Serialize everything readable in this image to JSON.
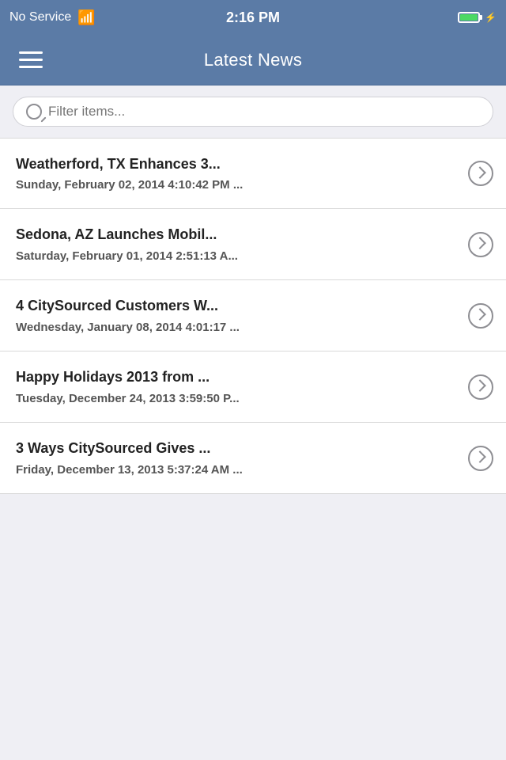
{
  "statusBar": {
    "signal": "No Service",
    "wifi": "⊙",
    "time": "2:16 PM"
  },
  "navBar": {
    "title": "Latest News",
    "menuIcon": "≡"
  },
  "search": {
    "placeholder": "Filter items..."
  },
  "newsItems": [
    {
      "title": "Weatherford, TX Enhances 3...",
      "date": "Sunday, February 02, 2014 4:10:42 PM ..."
    },
    {
      "title": "Sedona, AZ Launches Mobil...",
      "date": "Saturday, February 01, 2014 2:51:13 A..."
    },
    {
      "title": "4 CitySourced Customers W...",
      "date": "Wednesday, January 08, 2014 4:01:17 ..."
    },
    {
      "title": "Happy Holidays 2013 from ...",
      "date": "Tuesday, December 24, 2013 3:59:50 P..."
    },
    {
      "title": "3 Ways CitySourced Gives ...",
      "date": "Friday, December 13, 2013 5:37:24 AM ..."
    }
  ]
}
